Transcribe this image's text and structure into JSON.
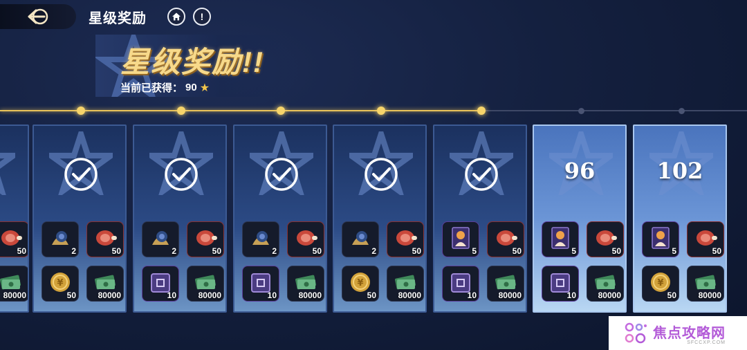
{
  "header": {
    "title": "星级奖励",
    "banner_title": "星级奖励!!",
    "current_label": "当前已获得：",
    "current_stars": "90"
  },
  "progress": {
    "stars_current": 90,
    "nodes_reached": 5,
    "nodes_total": 7
  },
  "cards": [
    {
      "state": "claimed",
      "star_req": "",
      "items": [
        {
          "icon": "meat-icon",
          "qty": "50"
        },
        {
          "icon": "cash-stack-icon",
          "qty": "80000"
        }
      ],
      "partial": true
    },
    {
      "state": "claimed",
      "star_req": "",
      "items": [
        {
          "icon": "snail-icon",
          "qty": "2"
        },
        {
          "icon": "meat-icon",
          "qty": "50"
        },
        {
          "icon": "gold-coin-icon",
          "qty": "50"
        },
        {
          "icon": "cash-stack-icon",
          "qty": "80000"
        }
      ]
    },
    {
      "state": "claimed",
      "star_req": "",
      "items": [
        {
          "icon": "snail-icon",
          "qty": "2"
        },
        {
          "icon": "meat-icon",
          "qty": "50"
        },
        {
          "icon": "chest-icon",
          "qty": "10"
        },
        {
          "icon": "cash-stack-icon",
          "qty": "80000"
        }
      ]
    },
    {
      "state": "claimed",
      "star_req": "",
      "items": [
        {
          "icon": "snail-icon",
          "qty": "2"
        },
        {
          "icon": "meat-icon",
          "qty": "50"
        },
        {
          "icon": "chest-icon",
          "qty": "10"
        },
        {
          "icon": "cash-stack-icon",
          "qty": "80000"
        }
      ]
    },
    {
      "state": "claimed",
      "star_req": "",
      "items": [
        {
          "icon": "snail-icon",
          "qty": "2"
        },
        {
          "icon": "meat-icon",
          "qty": "50"
        },
        {
          "icon": "gold-coin-icon",
          "qty": "50"
        },
        {
          "icon": "cash-stack-icon",
          "qty": "80000"
        }
      ]
    },
    {
      "state": "claimed",
      "star_req": "",
      "items": [
        {
          "icon": "character-card-icon",
          "qty": "5"
        },
        {
          "icon": "meat-icon",
          "qty": "50"
        },
        {
          "icon": "chest-icon",
          "qty": "10"
        },
        {
          "icon": "cash-stack-icon",
          "qty": "80000"
        }
      ]
    },
    {
      "state": "locked",
      "star_req": "96",
      "items": [
        {
          "icon": "character-card-icon",
          "qty": "5"
        },
        {
          "icon": "meat-icon",
          "qty": "50"
        },
        {
          "icon": "chest-icon",
          "qty": "10"
        },
        {
          "icon": "cash-stack-icon",
          "qty": "80000"
        }
      ]
    },
    {
      "state": "locked",
      "star_req": "102",
      "items": [
        {
          "icon": "character-card-icon",
          "qty": "5"
        },
        {
          "icon": "meat-icon",
          "qty": "50"
        },
        {
          "icon": "gold-coin-icon",
          "qty": "50"
        },
        {
          "icon": "cash-stack-icon",
          "qty": "80000"
        }
      ]
    }
  ],
  "watermark": {
    "main": "焦点攻略网",
    "sub": "SFCCXP.COM"
  },
  "colors": {
    "accent_gold": "#f2c64b",
    "track_active": "#e9c35a",
    "watermark": "#b35bd8"
  }
}
